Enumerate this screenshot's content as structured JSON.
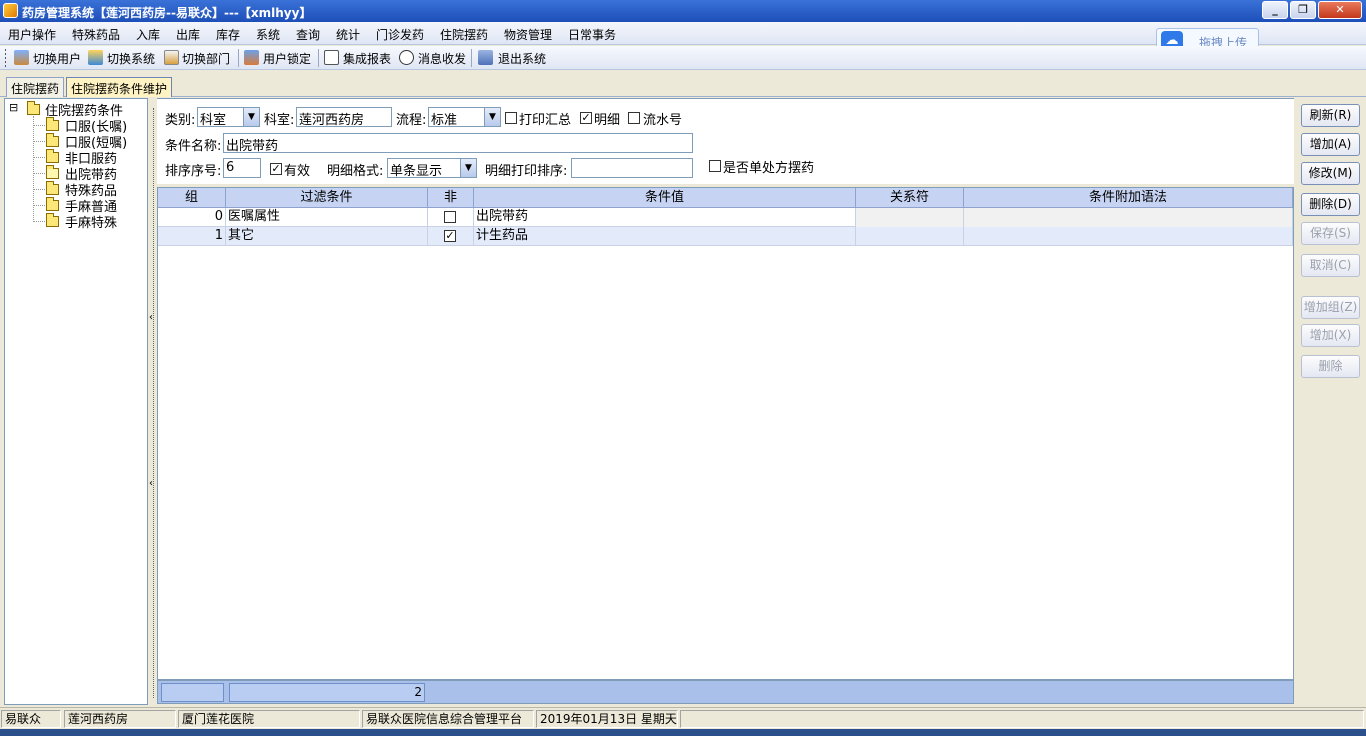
{
  "window": {
    "title": "药房管理系统【莲河西药房--易联众】---【xmlhyy】",
    "buttons": {
      "minimize": "_",
      "restore": "❐",
      "close": "✕"
    }
  },
  "menu": [
    "用户操作",
    "特殊药品",
    "入库",
    "出库",
    "库存",
    "系统",
    "查询",
    "统计",
    "门诊发药",
    "住院摆药",
    "物资管理",
    "日常事务"
  ],
  "upload": {
    "label": "拖拽上传",
    "icon": "cloud-icon"
  },
  "toolbar": {
    "switch_user": "切换用户",
    "switch_system": "切换系统",
    "switch_dept": "切换部门",
    "lock_user": "用户锁定",
    "report": "集成报表",
    "messages": "消息收发",
    "exit": "退出系统"
  },
  "tabs": [
    "住院摆药",
    "住院摆药条件维护"
  ],
  "tree": {
    "root": "住院摆药条件",
    "items": [
      "口服(长嘱)",
      "口服(短嘱)",
      "非口服药",
      "出院带药",
      "特殊药品",
      "手麻普通",
      "手麻特殊"
    ],
    "selected_index": 3,
    "toggle": "⊟"
  },
  "form": {
    "category_label": "类别:",
    "category_value": "科室",
    "dept_label": "科室:",
    "dept_value": "莲河西药房",
    "flow_label": "流程:",
    "flow_value": "标准",
    "print_summary_label": "打印汇总",
    "print_summary_checked": false,
    "detail_label": "明细",
    "detail_checked": true,
    "serial_label": "流水号",
    "serial_checked": false,
    "name_label": "条件名称:",
    "name_value": "出院带药",
    "order_label": "排序序号:",
    "order_value": "6",
    "valid_label": "有效",
    "valid_checked": true,
    "detail_format_label": "明细格式:",
    "detail_format_value": "单条显示",
    "detail_sort_label": "明细打印排序:",
    "detail_sort_value": "",
    "single_rx_label": "是否单处方摆药",
    "single_rx_checked": false
  },
  "grid": {
    "columns": [
      "组",
      "过滤条件",
      "非",
      "条件值",
      "关系符",
      "条件附加语法"
    ],
    "rows": [
      {
        "group": "0",
        "filter": "医嘱属性",
        "not": false,
        "value": "出院带药",
        "op": "",
        "extra": ""
      },
      {
        "group": "1",
        "filter": "其它",
        "not": true,
        "value": "计生药品",
        "op": "",
        "extra": ""
      }
    ],
    "footer_count": "2"
  },
  "right_buttons": {
    "refresh": "刷新(R)",
    "add": "增加(A)",
    "modify": "修改(M)",
    "delete": "删除(D)",
    "save": "保存(S)",
    "cancel": "取消(C)",
    "add_group": "增加组(Z)",
    "add_x": "增加(X)",
    "remove": "删除"
  },
  "status": {
    "user": "易联众",
    "pharmacy": "莲河西药房",
    "hospital": "厦门莲花医院",
    "platform": "易联众医院信息综合管理平台",
    "date": "2019年01月13日  星期天"
  },
  "colors": {
    "title_bar": "#2a5fc9",
    "grid_header": "#c6d3f2",
    "selected_row": "#e3ebfa",
    "active_tab": "#fff3c4"
  }
}
